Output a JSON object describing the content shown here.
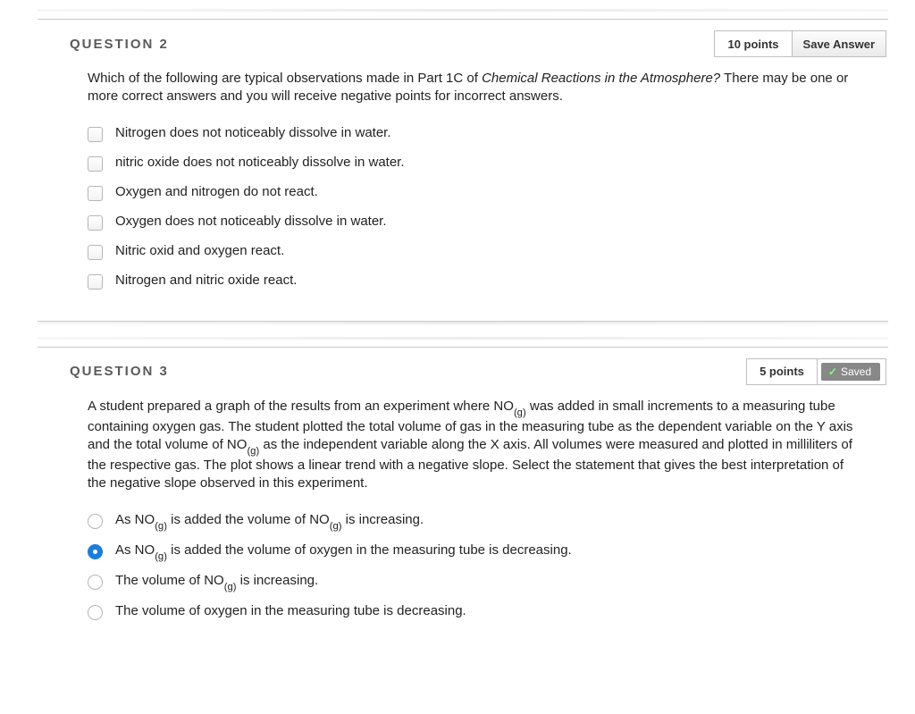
{
  "questions": [
    {
      "id": "q2",
      "title": "QUESTION 2",
      "points_label": "10 points",
      "save_label": "Save Answer",
      "saved": false,
      "prompt_html": "Which of the following are typical observations made in Part 1C of <em>Chemical Reactions in the Atmosphere?</em>  There may be one or more correct answers and you will receive negative points for incorrect answers.",
      "type": "checkbox",
      "options": [
        {
          "text": "Nitrogen does not noticeably dissolve in water.",
          "selected": false
        },
        {
          "text": "nitric oxide does not noticeably dissolve in water.",
          "selected": false
        },
        {
          "text": "Oxygen and nitrogen do not react.",
          "selected": false
        },
        {
          "text": "Oxygen does not noticeably dissolve in water.",
          "selected": false
        },
        {
          "text": "Nitric oxid and oxygen react.",
          "selected": false
        },
        {
          "text": "Nitrogen and nitric oxide react.",
          "selected": false
        }
      ]
    },
    {
      "id": "q3",
      "title": "QUESTION 3",
      "points_label": "5 points",
      "save_label": "Saved",
      "saved": true,
      "prompt_html": "A student prepared a graph of the results from an experiment where NO<sub>(g)</sub> was added in small increments to a measuring tube containing oxygen gas.  The student plotted the total volume of gas in the measuring tube as the dependent variable on the Y axis and the total volume of NO<sub>(g)</sub> as the independent variable along the X axis.  All volumes were measured and plotted in milliliters of the respective gas.  The plot shows a linear trend with a negative slope.  Select the statement that gives the best interpretation of the negative slope observed in this experiment.",
      "type": "radio",
      "options": [
        {
          "html": "As NO<sub>(g)</sub> is added the volume of NO<sub>(g)</sub> is increasing.",
          "selected": false
        },
        {
          "html": "As NO<sub>(g)</sub> is added the volume of oxygen in the measuring tube is decreasing.",
          "selected": true
        },
        {
          "html": "The volume of NO<sub>(g)</sub> is increasing.",
          "selected": false
        },
        {
          "html": "The volume of oxygen in the measuring tube is decreasing.",
          "selected": false
        }
      ]
    }
  ],
  "icons": {
    "check": "✓"
  }
}
